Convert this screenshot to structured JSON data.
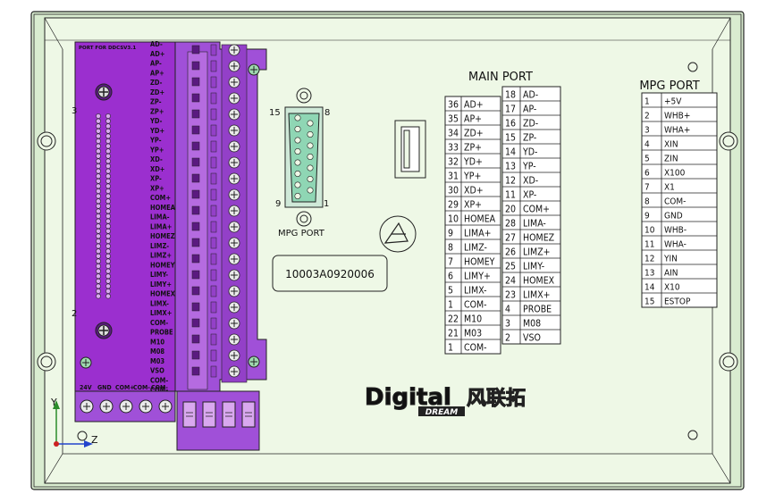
{
  "board": {
    "colors": {
      "panel": "#eef8e6",
      "frame": "#d9ecd0",
      "pcb": "#9b2fcf",
      "terminal": "#a050d8",
      "line": "#222222"
    },
    "port_title": "PORT FOR DDCSV3.1",
    "left_pin_labels": [
      "AD-",
      "AD+",
      "AP-",
      "AP+",
      "ZD-",
      "ZD+",
      "ZP-",
      "ZP+",
      "YD-",
      "YD+",
      "YP-",
      "YP+",
      "XD-",
      "XD+",
      "XP-",
      "XP+",
      "COM+",
      "HOMEA",
      "LIMA-",
      "LIMA+",
      "HOMEZ",
      "LIMZ-",
      "LIMZ+",
      "HOMEY",
      "LIMY-",
      "LIMY+",
      "HOMEX",
      "LIMX-",
      "LIMX+",
      "COM-",
      "PROBE",
      "M10",
      "M08",
      "M03",
      "VSO",
      "COM-",
      "COM-"
    ],
    "bottom_labels": [
      "24V",
      "GND",
      "COM+",
      "COM-",
      "COM-"
    ],
    "marker_3": "3",
    "marker_2": "2",
    "db15": {
      "label": "MPG PORT",
      "pin_15": "15",
      "pin_8": "8",
      "pin_9": "9",
      "pin_1": "1"
    },
    "serial": "10003A0920006",
    "brand": {
      "main": "Digital",
      "sub": "DREAM",
      "cn": "风联拓"
    },
    "axis": {
      "y": "Y",
      "z": "Z"
    }
  },
  "main_port": {
    "title": "MAIN PORT",
    "left_rows": [
      {
        "pin": "36",
        "sig": "AD+"
      },
      {
        "pin": "35",
        "sig": "AP+"
      },
      {
        "pin": "34",
        "sig": "ZD+"
      },
      {
        "pin": "33",
        "sig": "ZP+"
      },
      {
        "pin": "32",
        "sig": "YD+"
      },
      {
        "pin": "31",
        "sig": "YP+"
      },
      {
        "pin": "30",
        "sig": "XD+"
      },
      {
        "pin": "29",
        "sig": "XP+"
      },
      {
        "pin": "10",
        "sig": "HOMEA"
      },
      {
        "pin": "9",
        "sig": "LIMA+"
      },
      {
        "pin": "8",
        "sig": "LIMZ-"
      },
      {
        "pin": "7",
        "sig": "HOMEY"
      },
      {
        "pin": "6",
        "sig": "LIMY+"
      },
      {
        "pin": "5",
        "sig": "LIMX-"
      },
      {
        "pin": "1",
        "sig": "COM-"
      },
      {
        "pin": "22",
        "sig": "M10"
      },
      {
        "pin": "21",
        "sig": "M03"
      },
      {
        "pin": "1",
        "sig": "COM-"
      }
    ],
    "right_rows": [
      {
        "pin": "18",
        "sig": "AD-"
      },
      {
        "pin": "17",
        "sig": "AP-"
      },
      {
        "pin": "16",
        "sig": "ZD-"
      },
      {
        "pin": "15",
        "sig": "ZP-"
      },
      {
        "pin": "14",
        "sig": "YD-"
      },
      {
        "pin": "13",
        "sig": "YP-"
      },
      {
        "pin": "12",
        "sig": "XD-"
      },
      {
        "pin": "11",
        "sig": "XP-"
      },
      {
        "pin": "20",
        "sig": "COM+"
      },
      {
        "pin": "28",
        "sig": "LIMA-"
      },
      {
        "pin": "27",
        "sig": "HOMEZ"
      },
      {
        "pin": "26",
        "sig": "LIMZ+"
      },
      {
        "pin": "25",
        "sig": "LIMY-"
      },
      {
        "pin": "24",
        "sig": "HOMEX"
      },
      {
        "pin": "23",
        "sig": "LIMX+"
      },
      {
        "pin": "4",
        "sig": "PROBE"
      },
      {
        "pin": "3",
        "sig": "M08"
      },
      {
        "pin": "2",
        "sig": "VSO"
      }
    ]
  },
  "mpg_port": {
    "title": "MPG PORT",
    "rows": [
      {
        "pin": "1",
        "sig": "+5V"
      },
      {
        "pin": "2",
        "sig": "WHB+"
      },
      {
        "pin": "3",
        "sig": "WHA+"
      },
      {
        "pin": "4",
        "sig": "XIN"
      },
      {
        "pin": "5",
        "sig": "ZIN"
      },
      {
        "pin": "6",
        "sig": "X100"
      },
      {
        "pin": "7",
        "sig": "X1"
      },
      {
        "pin": "8",
        "sig": "COM-"
      },
      {
        "pin": "9",
        "sig": "GND"
      },
      {
        "pin": "10",
        "sig": "WHB-"
      },
      {
        "pin": "11",
        "sig": "WHA-"
      },
      {
        "pin": "12",
        "sig": "YIN"
      },
      {
        "pin": "13",
        "sig": "AIN"
      },
      {
        "pin": "14",
        "sig": "X10"
      },
      {
        "pin": "15",
        "sig": "ESTOP"
      }
    ]
  }
}
